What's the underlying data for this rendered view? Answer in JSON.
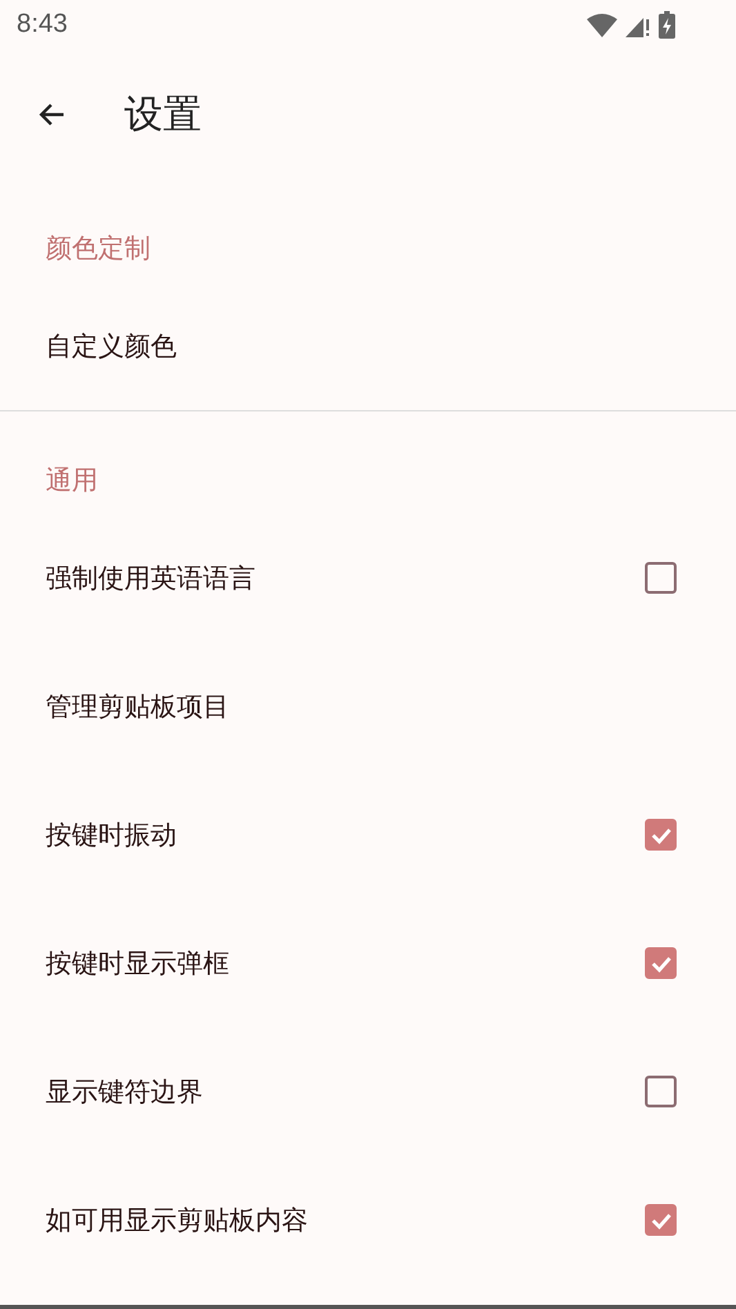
{
  "status_bar": {
    "time": "8:43"
  },
  "app_bar": {
    "title": "设置"
  },
  "sections": [
    {
      "header": "颜色定制",
      "items": [
        {
          "kind": "plain",
          "label": "自定义颜色"
        }
      ]
    },
    {
      "header": "通用",
      "items": [
        {
          "kind": "checkbox",
          "label": "强制使用英语语言",
          "checked": false
        },
        {
          "kind": "plain",
          "label": "管理剪贴板项目"
        },
        {
          "kind": "checkbox",
          "label": "按键时振动",
          "checked": true
        },
        {
          "kind": "checkbox",
          "label": "按键时显示弹框",
          "checked": true
        },
        {
          "kind": "checkbox",
          "label": "显示键符边界",
          "checked": false
        },
        {
          "kind": "checkbox",
          "label": "如可用显示剪贴板内容",
          "checked": true
        }
      ]
    }
  ]
}
